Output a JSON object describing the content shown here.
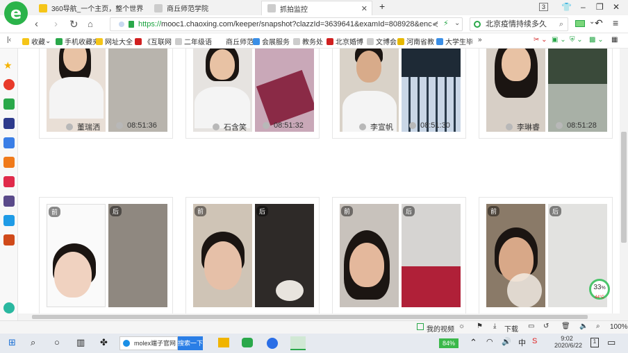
{
  "browser": {
    "tabs": [
      {
        "label": "360导航_一个主页，整个世界",
        "active": false
      },
      {
        "label": "商丘师范学院",
        "active": false
      },
      {
        "label": "抓拍监控",
        "active": true
      }
    ],
    "tab_count": "3",
    "url_scheme": "https://",
    "url_rest": "mooc1.chaoxing.com/keeper/snapshot?clazzId=3639641&examId=808928&enc",
    "search_text": "北京疫情持续多久",
    "bookmarks": [
      "收藏",
      "手机收藏夹",
      "网址大全",
      "《互联网",
      "二年级语",
      "商丘师范",
      "会展服务",
      "教务处",
      "北京婚博",
      "文博会",
      "河南省教",
      "大学生毕"
    ],
    "bookmark_more": "»"
  },
  "students_row1": [
    {
      "name": "董瑞洒",
      "time": "08:51:36"
    },
    {
      "name": "石含笑",
      "time": "08:51:32"
    },
    {
      "name": "李宣帆",
      "time": "08:51:30"
    },
    {
      "name": "李琳睿",
      "time": "08:51:28"
    }
  ],
  "photo_tags": {
    "front": "前",
    "back": "后"
  },
  "status": {
    "video": "我的视频",
    "download": "下载",
    "zoom": "100%"
  },
  "badge": {
    "value": "33",
    "unit": "%",
    "sub": "44°C"
  },
  "taskbar": {
    "search_app": "molex端子官网",
    "search_btn": "搜索一下",
    "battery": "84%",
    "ime": "中",
    "time": "9:02",
    "date": "2020/6/22",
    "notif": "1"
  }
}
